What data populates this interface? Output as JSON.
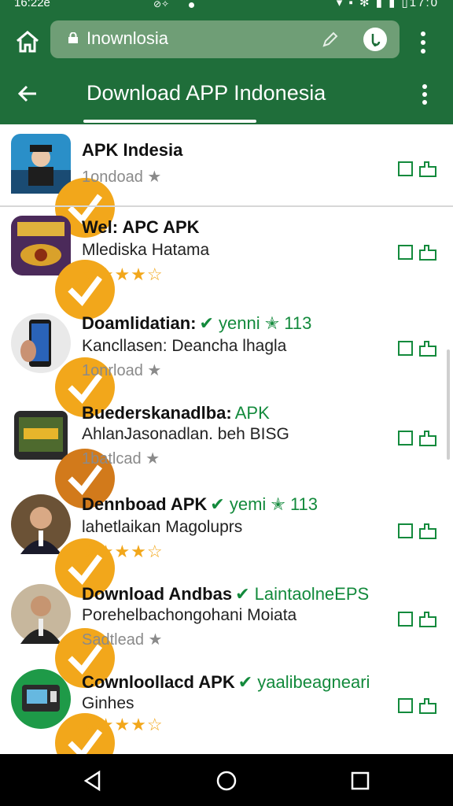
{
  "status": {
    "time": "16:22e",
    "right": "▾ ▪ ✻ ▮ ▮ ▯17:0"
  },
  "browser": {
    "url_text": "Inownlosia"
  },
  "appbar": {
    "title": "Download APP Indonesia"
  },
  "items": [
    {
      "name": "APK Indesia",
      "tag": "",
      "sub": "",
      "meta": "1ondoad ★",
      "stars": ""
    },
    {
      "name": "Wel: APC APK",
      "tag": "",
      "sub": "Mlediska Hatama",
      "meta": "",
      "stars": "★★★★☆"
    },
    {
      "name": "Doamlidatian:",
      "tag": "✔ yenni ✭ 113",
      "sub": "Kancllasen: Deancha lhagla",
      "meta": "1onrload ★",
      "stars": ""
    },
    {
      "name": "Buederskanadlba:",
      "tag": "APK",
      "sub": "AhlanJasonadlan. beh BISG",
      "meta": "1batlcad ★",
      "stars": ""
    },
    {
      "name": "Dennboad APK",
      "tag": "✔ yemi ✭ 113",
      "sub": "lahetlaikan Magoluprs",
      "meta": "",
      "stars": "★★★★☆"
    },
    {
      "name": "Download Andbas",
      "tag": "✔ LaintaolneEPS",
      "sub": "Porehelbachongohani Moiata",
      "meta": "Sadtlead ★",
      "stars": ""
    },
    {
      "name": "Cownloollacd APK",
      "tag": "✔ yaalibeagneari",
      "sub": "Ginhes",
      "meta": "",
      "stars": "★★★★☆"
    }
  ],
  "colors": {
    "brand": "#1f6e3a",
    "accent": "#f2a71b"
  }
}
